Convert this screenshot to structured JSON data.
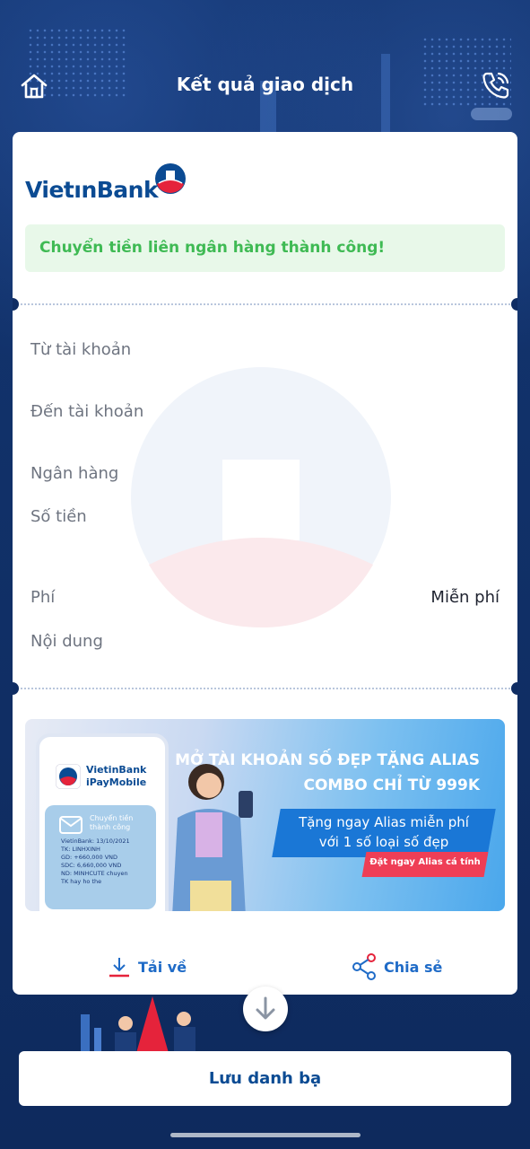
{
  "header": {
    "title": "Kết quả giao dịch",
    "home_icon": "home-icon",
    "call_icon": "phone-icon"
  },
  "brand": {
    "name": "VietınBank",
    "primary_color": "#0b4b93",
    "accent_red": "#e5233b"
  },
  "status": {
    "message": "Chuyển tiền liên ngân hàng thành công!",
    "color": "#3fba54"
  },
  "details": {
    "from_account_label": "Từ tài khoản",
    "to_account_label": "Đến tài khoản",
    "bank_label": "Ngân hàng",
    "amount_label": "Số tiền",
    "fee_label": "Phí",
    "fee_value": "Miễn phí",
    "content_label": "Nội dung"
  },
  "banner": {
    "headline_1": "MỞ TÀI KHOẢN SỐ ĐẸP TẶNG ALIAS",
    "headline_2": "COMBO CHỈ TỪ 999K",
    "promo_1": "Tặng ngay Alias miễn phí",
    "promo_2": "với 1 số loại số đẹp",
    "cta": "Đặt ngay Alias cá tính",
    "phone_brand_1": "VietinBank",
    "phone_brand_2": "iPayMobile",
    "receipt_title": "Chuyển tiền thành công",
    "receipt_lines": "VietinBank: 13/10/2021\nTK: LINHXINH\nGD: +660,000 VND\nSDC: 6,660,000 VND\nND: MINHCUTE chuyen\nTK hay ho the"
  },
  "actions": {
    "download_label": "Tải về",
    "share_label": "Chia sẻ"
  },
  "footer": {
    "save_contact_label": "Lưu danh bạ"
  }
}
